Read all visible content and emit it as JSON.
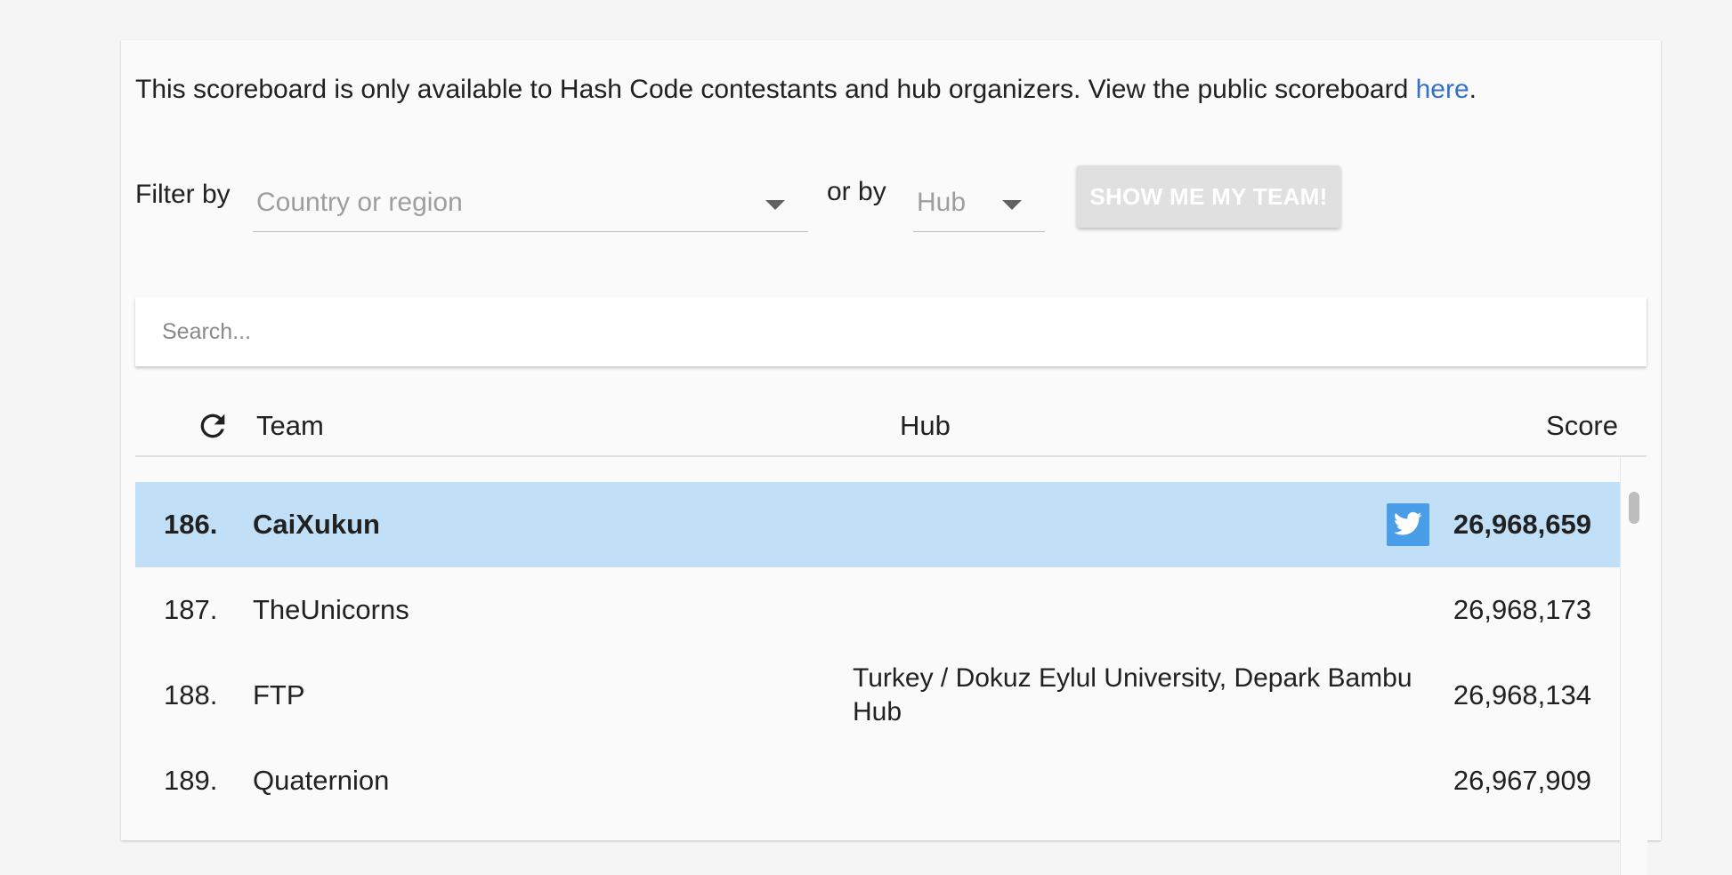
{
  "notice": {
    "text": "This scoreboard is only available to Hash Code contestants and hub organizers. View the public scoreboard ",
    "link_text": "here",
    "suffix": "."
  },
  "filters": {
    "filter_label": "Filter by",
    "country_placeholder": "Country or region",
    "or_label": "or by",
    "hub_placeholder": "Hub",
    "my_team_button": "SHOW ME MY TEAM!"
  },
  "search": {
    "placeholder": "Search..."
  },
  "table": {
    "headers": {
      "team": "Team",
      "hub": "Hub",
      "score": "Score"
    },
    "rows": [
      {
        "rank": "186.",
        "team": "CaiXukun",
        "hub": "",
        "score": "26,968,659",
        "highlighted": true,
        "icon": "twitter-icon"
      },
      {
        "rank": "187.",
        "team": "TheUnicorns",
        "hub": "",
        "score": "26,968,173"
      },
      {
        "rank": "188.",
        "team": "FTP",
        "hub": "Turkey / Dokuz Eylul University, Depark Bambu Hub",
        "score": "26,968,134"
      },
      {
        "rank": "189.",
        "team": "Quaternion",
        "hub": "",
        "score": "26,967,909"
      }
    ]
  },
  "colors": {
    "link": "#3572c6",
    "highlight_row": "#c2dff8",
    "twitter": "#4a9ee8"
  }
}
